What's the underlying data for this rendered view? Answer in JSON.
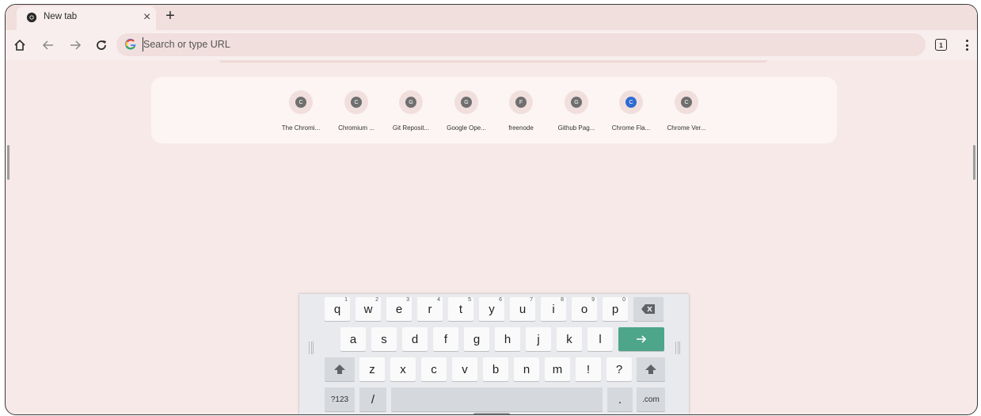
{
  "tab": {
    "title": "New tab",
    "close": "×",
    "new_tab": "+"
  },
  "toolbar": {
    "placeholder": "Search or type URL",
    "tab_count": "1"
  },
  "shortcuts": [
    {
      "letter": "C",
      "label": "The Chromi..."
    },
    {
      "letter": "C",
      "label": "Chromium ..."
    },
    {
      "letter": "G",
      "label": "Git Reposit..."
    },
    {
      "letter": "G",
      "label": "Google Ope..."
    },
    {
      "letter": "F",
      "label": "freenode"
    },
    {
      "letter": "G",
      "label": "Github Pag..."
    },
    {
      "letter": "C",
      "label": "Chrome Fla...",
      "accent": "#2f6bd3"
    },
    {
      "letter": "C",
      "label": "Chrome Ver..."
    }
  ],
  "keyboard": {
    "row1": [
      {
        "key": "q",
        "hint": "1"
      },
      {
        "key": "w",
        "hint": "2"
      },
      {
        "key": "e",
        "hint": "3"
      },
      {
        "key": "r",
        "hint": "4"
      },
      {
        "key": "t",
        "hint": "5"
      },
      {
        "key": "y",
        "hint": "6"
      },
      {
        "key": "u",
        "hint": "7"
      },
      {
        "key": "i",
        "hint": "8"
      },
      {
        "key": "o",
        "hint": "9"
      },
      {
        "key": "p",
        "hint": "0"
      }
    ],
    "row2": [
      "a",
      "s",
      "d",
      "f",
      "g",
      "h",
      "j",
      "k",
      "l"
    ],
    "row3": [
      "z",
      "x",
      "c",
      "v",
      "b",
      "n",
      "m",
      "!",
      "?"
    ],
    "symbols": "?123",
    "slash": "/",
    "period": ".",
    "dotcom": ".com",
    "enter_color": "#4da58a"
  },
  "colors": {
    "frame_bg": "#f6e9e8",
    "omnibox_bg": "#f1dfdd"
  }
}
